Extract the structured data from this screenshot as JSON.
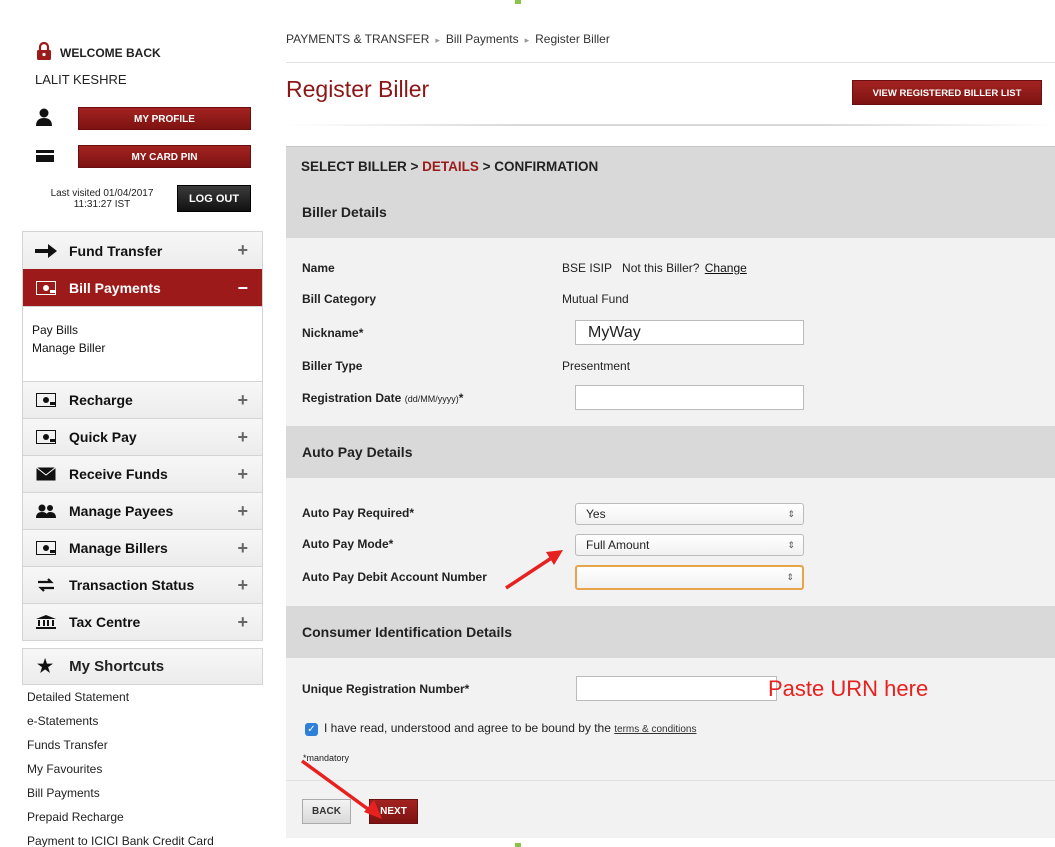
{
  "user": {
    "welcome": "WELCOME BACK",
    "name": "LALIT KESHRE",
    "my_profile": "MY PROFILE",
    "my_card_pin": "MY CARD PIN",
    "last_visited_line1": "Last visited 01/04/2017",
    "last_visited_line2": "11:31:27 IST",
    "logout": "LOG OUT"
  },
  "menu": {
    "items": [
      {
        "label": "Fund Transfer",
        "icon": "arrow-right-icon"
      },
      {
        "label": "Bill Payments",
        "icon": "bill-icon",
        "toggle": "−"
      },
      {
        "label": "Recharge",
        "icon": "bill-icon"
      },
      {
        "label": "Quick Pay",
        "icon": "bill-icon"
      },
      {
        "label": "Receive Funds",
        "icon": "envelope-icon"
      },
      {
        "label": "Manage Payees",
        "icon": "people-icon"
      },
      {
        "label": "Manage Billers",
        "icon": "bill-icon"
      },
      {
        "label": "Transaction Status",
        "icon": "dollar-icon"
      },
      {
        "label": "Tax Centre",
        "icon": "bank-icon"
      }
    ],
    "plus": "+",
    "bill_submenu": [
      "Pay Bills",
      "Manage Biller"
    ]
  },
  "shortcuts": {
    "title": "My Shortcuts",
    "items": [
      "Detailed Statement",
      "e-Statements",
      "Funds Transfer",
      "My Favourites",
      "Bill Payments",
      "Prepaid Recharge",
      "Payment to ICICI Bank Credit Card"
    ]
  },
  "breadcrumb": [
    "PAYMENTS & TRANSFER",
    "Bill Payments",
    "Register Biller"
  ],
  "breadcrumb_sep": "▸",
  "page_title": "Register Biller",
  "view_list_button": "VIEW REGISTERED BILLER LIST",
  "steps": {
    "step1": "SELECT BILLER > ",
    "step2": "DETAILS",
    "step3": " > CONFIRMATION"
  },
  "biller_details": {
    "heading": "Biller Details",
    "name_label": "Name",
    "name_value": "BSE ISIP",
    "not_this_biller": "Not this Biller?",
    "change_link": "Change",
    "category_label": "Bill Category",
    "category_value": "Mutual Fund",
    "nickname_label": "Nickname*",
    "nickname_value": "MyWay",
    "type_label": "Biller Type",
    "type_value": "Presentment",
    "regdate_label": "Registration Date",
    "regdate_format": "(dd/MM/yyyy)",
    "regdate_star": "*",
    "regdate_value": ""
  },
  "auto_pay": {
    "heading": "Auto Pay Details",
    "required_label": "Auto Pay Required*",
    "required_value": "Yes",
    "mode_label": "Auto Pay Mode*",
    "mode_value": "Full Amount",
    "debit_label": "Auto Pay Debit Account Number",
    "debit_value": "",
    "select_arrow": "⇕"
  },
  "consumer": {
    "heading": "Consumer Identification Details",
    "urn_label": "Unique Registration Number*",
    "urn_value": "",
    "annotation": "Paste URN here",
    "agree_text": "I have read, understood and agree to be bound by the",
    "terms_link": "terms & conditions",
    "checkbox_mark": "✓",
    "mandatory": "*mandatory"
  },
  "buttons": {
    "back": "BACK",
    "next": "NEXT"
  },
  "colors": {
    "brand": "#9d1a1a",
    "annotation": "#e6211f",
    "checkbox": "#2d7fd8"
  }
}
